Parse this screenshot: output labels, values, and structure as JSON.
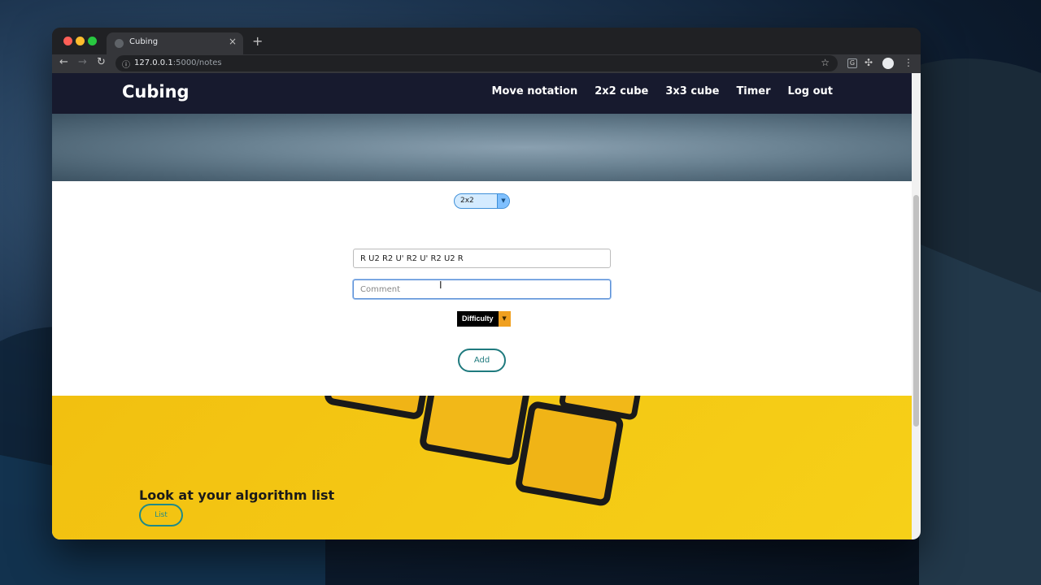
{
  "browser": {
    "tab_title": "Cubing",
    "tab_close": "×",
    "new_tab": "+",
    "url_host": "127.0.0.1",
    "url_path": ":5000/notes",
    "ext_label": "G"
  },
  "site": {
    "brand": "Cubing",
    "nav": [
      "Move notation",
      "2x2 cube",
      "3x3 cube",
      "Timer",
      "Log out"
    ]
  },
  "form": {
    "cube_select_value": "2x2",
    "algorithm_value": "R U2 R2 U' R2 U' R2 U2 R",
    "comment_placeholder": "Comment",
    "difficulty_label": "Difficulty",
    "add_label": "Add"
  },
  "list_section": {
    "title": "Look at your algorithm list",
    "button_label": "List"
  },
  "colors": {
    "header_bg": "#171a2e",
    "accent_teal": "#1f7a7e",
    "section_yellow": "#f4c814"
  }
}
